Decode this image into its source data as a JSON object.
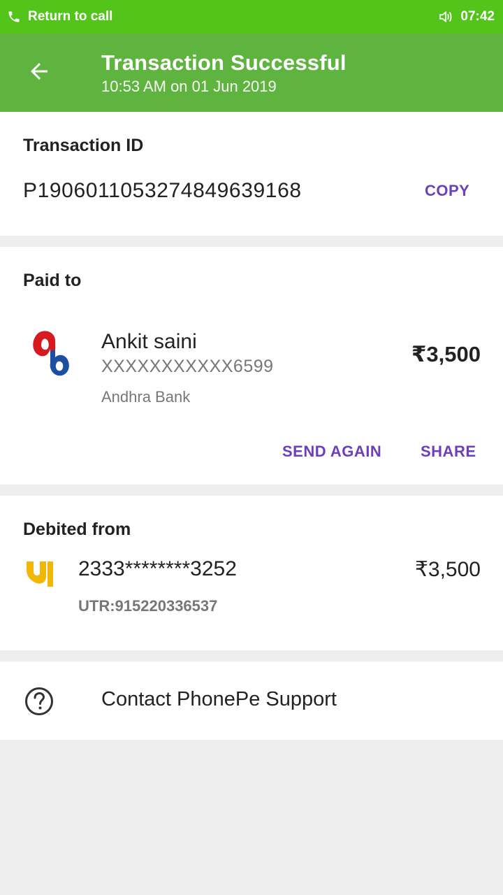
{
  "status_bar": {
    "call_label": "Return to call",
    "time": "07:42"
  },
  "header": {
    "title": "Transaction Successful",
    "subtitle": "10:53 AM on 01 Jun 2019"
  },
  "transaction": {
    "section_label": "Transaction ID",
    "id": "P1906011053274849639168",
    "copy_label": "COPY"
  },
  "paid_to": {
    "section_label": "Paid to",
    "name": "Ankit saini",
    "account": "XXXXXXXXXXX6599",
    "bank": "Andhra Bank",
    "amount": "₹3,500",
    "send_again_label": "SEND AGAIN",
    "share_label": "SHARE"
  },
  "debited_from": {
    "section_label": "Debited from",
    "account": "2333********3252",
    "amount": "₹3,500",
    "utr": "UTR:915220336537"
  },
  "support": {
    "label": "Contact PhonePe Support"
  },
  "icons": {
    "phone": "phone-icon",
    "speaker": "speaker-icon",
    "back": "back-arrow-icon",
    "bank_logo": "andhra-bank-logo-icon",
    "debit_logo": "punjab-national-bank-logo-icon",
    "help": "help-circle-icon"
  },
  "colors": {
    "status_bar": "#52c41a",
    "header": "#5fb33f",
    "accent": "#6b3fbd",
    "background": "#eeeeee"
  }
}
